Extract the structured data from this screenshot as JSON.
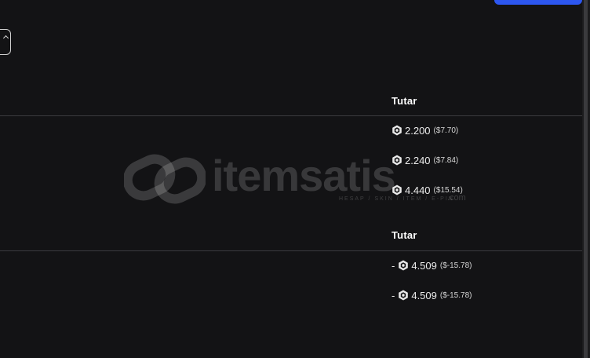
{
  "colors": {
    "background": "#131315",
    "accent_button": "#2d57f0",
    "divider": "#3b3b3f",
    "text": "#ececec"
  },
  "icons": {
    "coin": "coin-icon",
    "back": "chevron-up-icon"
  },
  "watermark": {
    "text": "itemsatis",
    "tagline": "HESAP / SKIN / ITEM / E-PIN",
    "suffix": ".com"
  },
  "income_table": {
    "header": "Tutar",
    "rows": [
      {
        "amount": "2.200",
        "usd": "($7.70)"
      },
      {
        "amount": "2.240",
        "usd": "($7.84)"
      },
      {
        "amount": "4.440",
        "usd": "($15.54)"
      }
    ]
  },
  "expense_table": {
    "header": "Tutar",
    "rows": [
      {
        "prefix": "-",
        "amount": "4.509",
        "usd": "($-15.78)"
      },
      {
        "prefix": "-",
        "amount": "4.509",
        "usd": "($-15.78)"
      }
    ]
  }
}
